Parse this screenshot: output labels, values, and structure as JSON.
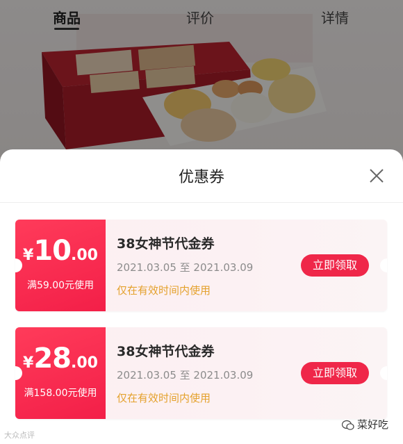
{
  "tabs": [
    {
      "label": "商品",
      "active": true
    },
    {
      "label": "评价",
      "active": false
    },
    {
      "label": "详情",
      "active": false
    }
  ],
  "sheet": {
    "title": "优惠券",
    "close_icon": "close-icon"
  },
  "coupons": [
    {
      "currency": "¥",
      "amount_int": "10",
      "amount_dec": ".00",
      "condition": "满59.00元使用",
      "name": "38女神节代金券",
      "date_range": "2021.03.05 至 2021.03.09",
      "note": "仅在有效时间内使用",
      "button_label": "立即领取"
    },
    {
      "currency": "¥",
      "amount_int": "28",
      "amount_dec": ".00",
      "condition": "满158.00元使用",
      "name": "38女神节代金券",
      "date_range": "2021.03.05 至 2021.03.09",
      "note": "仅在有效时间内使用",
      "button_label": "立即领取"
    }
  ],
  "watermarks": {
    "left": "大众点评",
    "right": "菜好吃"
  },
  "colors": {
    "accent_red": "#ef2749",
    "note_orange": "#e4a12c"
  }
}
